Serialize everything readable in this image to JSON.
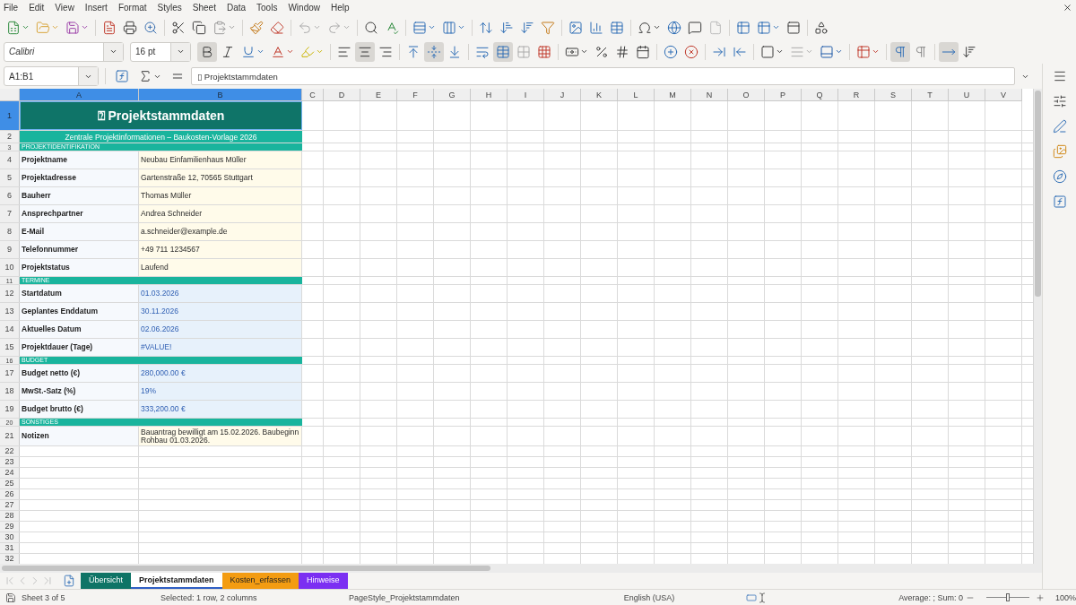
{
  "menu": [
    "File",
    "Edit",
    "View",
    "Insert",
    "Format",
    "Styles",
    "Sheet",
    "Data",
    "Tools",
    "Window",
    "Help"
  ],
  "format_toolbar": {
    "font": "Calibri",
    "size": "16 pt",
    "groups": [
      [
        {
          "kind": "bold",
          "on": true
        },
        {
          "kind": "italic",
          "on": false
        },
        {
          "kind": "underline",
          "on": false
        },
        {
          "kind": "font-color",
          "on": false
        },
        {
          "kind": "highlight",
          "on": false
        }
      ],
      [
        {
          "kind": "align-left",
          "on": false
        },
        {
          "kind": "align-center",
          "on": true
        },
        {
          "kind": "align-right",
          "on": false
        }
      ],
      [
        {
          "kind": "align-top",
          "on": false
        },
        {
          "kind": "align-middle",
          "on": true
        },
        {
          "kind": "align-bottom",
          "on": false
        }
      ],
      [
        {
          "kind": "wrap",
          "on": false
        },
        {
          "kind": "merge-center",
          "on": true
        },
        {
          "kind": "merge",
          "on": false
        },
        {
          "kind": "unmerge",
          "on": false
        }
      ],
      [
        {
          "kind": "number-format",
          "on": false
        },
        {
          "kind": "percent",
          "on": false
        },
        {
          "kind": "standard-format",
          "on": false
        },
        {
          "kind": "date-format",
          "on": false
        }
      ],
      [
        {
          "kind": "add-decimal",
          "on": false
        },
        {
          "kind": "remove-decimal",
          "on": false
        }
      ],
      [
        {
          "kind": "indent-increase",
          "on": false
        },
        {
          "kind": "indent-decrease",
          "on": false
        }
      ],
      [
        {
          "kind": "borders",
          "on": false
        },
        {
          "kind": "border-style",
          "on": false
        },
        {
          "kind": "border-color",
          "on": false
        }
      ],
      [
        {
          "kind": "conditional",
          "on": false
        }
      ],
      [
        {
          "kind": "ltr",
          "on": true
        },
        {
          "kind": "rtl",
          "on": false
        }
      ],
      [
        {
          "kind": "text-horizontal",
          "on": true
        },
        {
          "kind": "text-vertical",
          "on": false
        }
      ]
    ]
  },
  "formula_bar": {
    "name_box": "A1:B1",
    "content": "▯ Projektstammdaten"
  },
  "columns": [
    {
      "label": "A",
      "selected": true
    },
    {
      "label": "B",
      "selected": true
    },
    {
      "label": "C",
      "selected": false
    },
    {
      "label": "D",
      "selected": false
    },
    {
      "label": "E",
      "selected": false
    },
    {
      "label": "F",
      "selected": false
    },
    {
      "label": "G",
      "selected": false
    },
    {
      "label": "H",
      "selected": false
    },
    {
      "label": "I",
      "selected": false
    },
    {
      "label": "J",
      "selected": false
    },
    {
      "label": "K",
      "selected": false
    },
    {
      "label": "L",
      "selected": false
    },
    {
      "label": "M",
      "selected": false
    },
    {
      "label": "N",
      "selected": false
    },
    {
      "label": "O",
      "selected": false
    },
    {
      "label": "P",
      "selected": false
    },
    {
      "label": "Q",
      "selected": false
    },
    {
      "label": "R",
      "selected": false
    },
    {
      "label": "S",
      "selected": false
    },
    {
      "label": "T",
      "selected": false
    },
    {
      "label": "U",
      "selected": false
    },
    {
      "label": "V",
      "selected": false
    }
  ],
  "rows": [
    {
      "header": "1",
      "kind": "title",
      "selected": true,
      "text": "⍰ Projektstammdaten"
    },
    {
      "header": "2",
      "kind": "subtitle",
      "selected": false,
      "text": "Zentrale Projektinformationen – Baukosten-Vorlage 2026"
    },
    {
      "header": "3",
      "kind": "section",
      "selected": false,
      "text": "PROJEKTIDENTIFIKATION"
    },
    {
      "header": "4",
      "kind": "field",
      "selected": false,
      "label": "Projektname",
      "value": "Neubau Einfamilienhaus Müller",
      "computed": false
    },
    {
      "header": "5",
      "kind": "field",
      "selected": false,
      "label": "Projektadresse",
      "value": "Gartenstraße 12, 70565 Stuttgart",
      "computed": false
    },
    {
      "header": "6",
      "kind": "field",
      "selected": false,
      "label": "Bauherr",
      "value": "Thomas Müller",
      "computed": false
    },
    {
      "header": "7",
      "kind": "field",
      "selected": false,
      "label": "Ansprechpartner",
      "value": "Andrea Schneider",
      "computed": false
    },
    {
      "header": "8",
      "kind": "field",
      "selected": false,
      "label": "E-Mail",
      "value": "a.schneider@example.de",
      "computed": false
    },
    {
      "header": "9",
      "kind": "field",
      "selected": false,
      "label": "Telefonnummer",
      "value": "+49 711 1234567",
      "computed": false
    },
    {
      "header": "10",
      "kind": "field",
      "selected": false,
      "label": "Projektstatus",
      "value": "Laufend",
      "computed": false
    },
    {
      "header": "11",
      "kind": "section",
      "selected": false,
      "text": "TERMINE"
    },
    {
      "header": "12",
      "kind": "field",
      "selected": false,
      "label": "Startdatum",
      "value": "01.03.2026",
      "computed": true
    },
    {
      "header": "13",
      "kind": "field",
      "selected": false,
      "label": "Geplantes Enddatum",
      "value": "30.11.2026",
      "computed": true
    },
    {
      "header": "14",
      "kind": "field",
      "selected": false,
      "label": "Aktuelles Datum",
      "value": "02.06.2026",
      "computed": true
    },
    {
      "header": "15",
      "kind": "field",
      "selected": false,
      "label": "Projektdauer (Tage)",
      "value": "#VALUE!",
      "computed": true
    },
    {
      "header": "16",
      "kind": "section",
      "selected": false,
      "text": "BUDGET"
    },
    {
      "header": "17",
      "kind": "field",
      "selected": false,
      "label": "Budget netto (€)",
      "value": "280,000.00 €",
      "computed": true
    },
    {
      "header": "18",
      "kind": "field",
      "selected": false,
      "label": "MwSt.-Satz (%)",
      "value": "19%",
      "computed": true
    },
    {
      "header": "19",
      "kind": "field",
      "selected": false,
      "label": "Budget brutto (€)",
      "value": "333,200.00 €",
      "computed": true
    },
    {
      "header": "20",
      "kind": "section",
      "selected": false,
      "text": "SONSTIGES"
    },
    {
      "header": "21",
      "kind": "note",
      "selected": false,
      "label": "Notizen",
      "value": "Bauantrag bewilligt am 15.02.2026. Baubeginn Rohbau 01.03.2026.",
      "computed": false
    },
    {
      "header": "22",
      "kind": "empty",
      "selected": false
    },
    {
      "header": "23",
      "kind": "empty",
      "selected": false
    },
    {
      "header": "24",
      "kind": "empty",
      "selected": false
    },
    {
      "header": "25",
      "kind": "empty",
      "selected": false
    },
    {
      "header": "26",
      "kind": "empty",
      "selected": false
    },
    {
      "header": "27",
      "kind": "empty",
      "selected": false
    },
    {
      "header": "28",
      "kind": "empty",
      "selected": false
    },
    {
      "header": "29",
      "kind": "empty",
      "selected": false
    },
    {
      "header": "30",
      "kind": "empty",
      "selected": false
    },
    {
      "header": "31",
      "kind": "empty",
      "selected": false
    },
    {
      "header": "32",
      "kind": "empty",
      "selected": false
    }
  ],
  "sheets": [
    {
      "label": "Übersicht",
      "selected": false,
      "color": "#0f7466"
    },
    {
      "label": "Projektstammdaten",
      "selected": true
    },
    {
      "label": "Kosten_erfassen",
      "selected": false,
      "color": "#f39c12"
    },
    {
      "label": "Hinweise",
      "selected": false,
      "color": "#7b2ff2"
    }
  ],
  "status_bar": {
    "sheet": "Sheet 3 of 5",
    "selection": "Selected: 1 row, 2 columns",
    "page_style": "PageStyle_Projektstammdaten",
    "language": "English (USA)",
    "summary": "Average: ; Sum: 0",
    "zoom": {
      "level": 0.5,
      "reading": "100%"
    }
  }
}
